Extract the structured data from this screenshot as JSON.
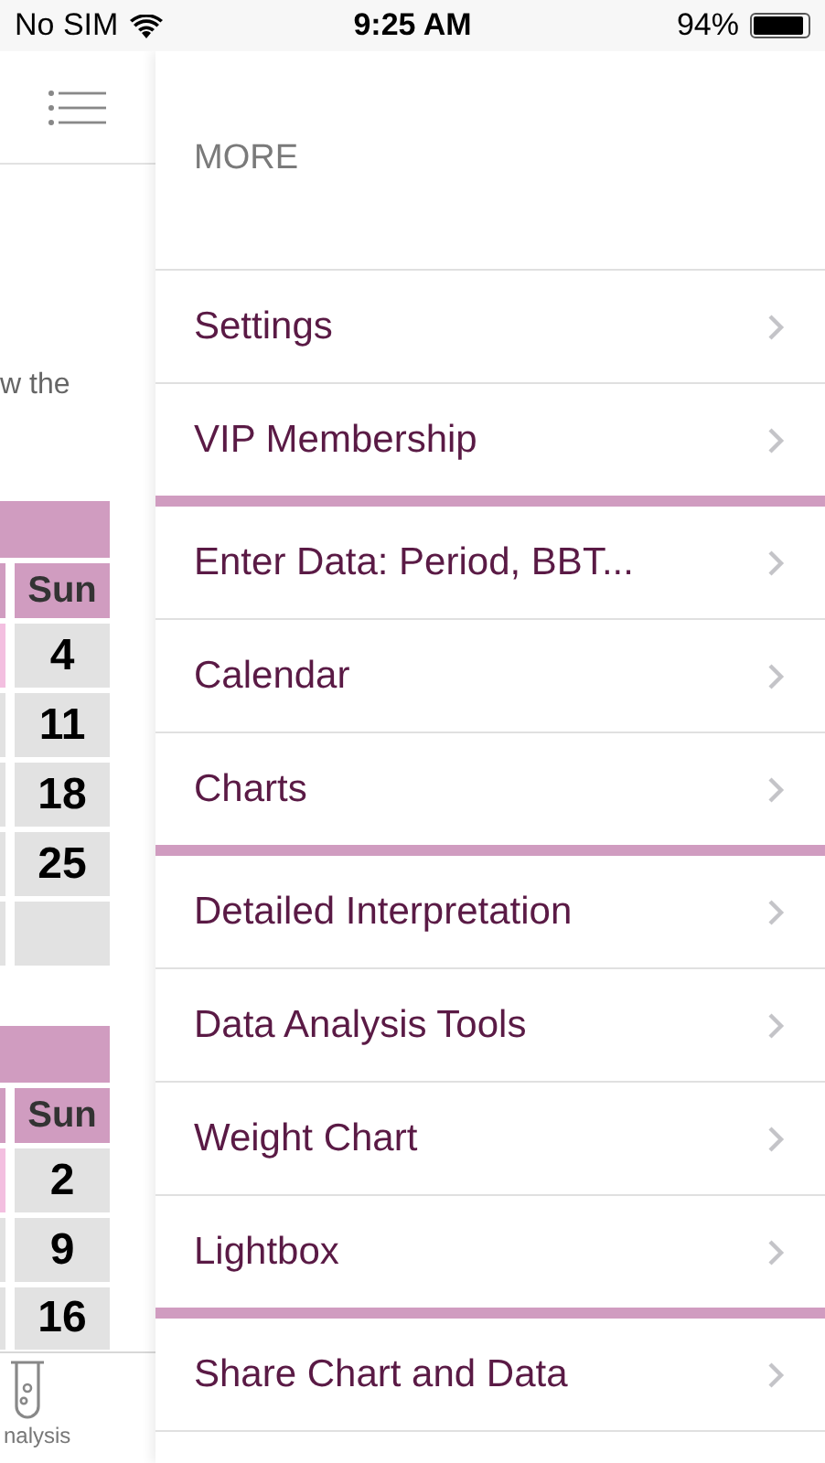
{
  "status_bar": {
    "carrier": "No SIM",
    "time": "9:25 AM",
    "battery": "94%"
  },
  "background": {
    "hint": "w the",
    "calendars": [
      {
        "day_header": "Sun",
        "rows": [
          {
            "kind": "date",
            "day": "4",
            "neighbor_highlighted": true
          },
          {
            "kind": "date",
            "day": "11",
            "neighbor_highlighted": false
          },
          {
            "kind": "date",
            "day": "18",
            "neighbor_highlighted": false
          },
          {
            "kind": "date",
            "day": "25",
            "neighbor_highlighted": false
          },
          {
            "kind": "blank",
            "neighbor_highlighted": false
          }
        ]
      },
      {
        "day_header": "Sun",
        "rows": [
          {
            "kind": "date",
            "day": "2",
            "neighbor_highlighted": true
          },
          {
            "kind": "date",
            "day": "9",
            "neighbor_highlighted": false
          },
          {
            "kind": "date",
            "day": "16",
            "neighbor_highlighted": false
          }
        ]
      }
    ],
    "tab_bar": {
      "label": "nalysis"
    }
  },
  "drawer": {
    "title": "MORE",
    "sections": [
      {
        "items": [
          "Settings",
          "VIP Membership"
        ]
      },
      {
        "items": [
          "Enter Data: Period, BBT...",
          "Calendar",
          "Charts"
        ]
      },
      {
        "items": [
          "Detailed Interpretation",
          "Data Analysis Tools",
          "Weight Chart",
          "Lightbox"
        ]
      },
      {
        "items": [
          "Share Chart and Data"
        ]
      }
    ]
  }
}
